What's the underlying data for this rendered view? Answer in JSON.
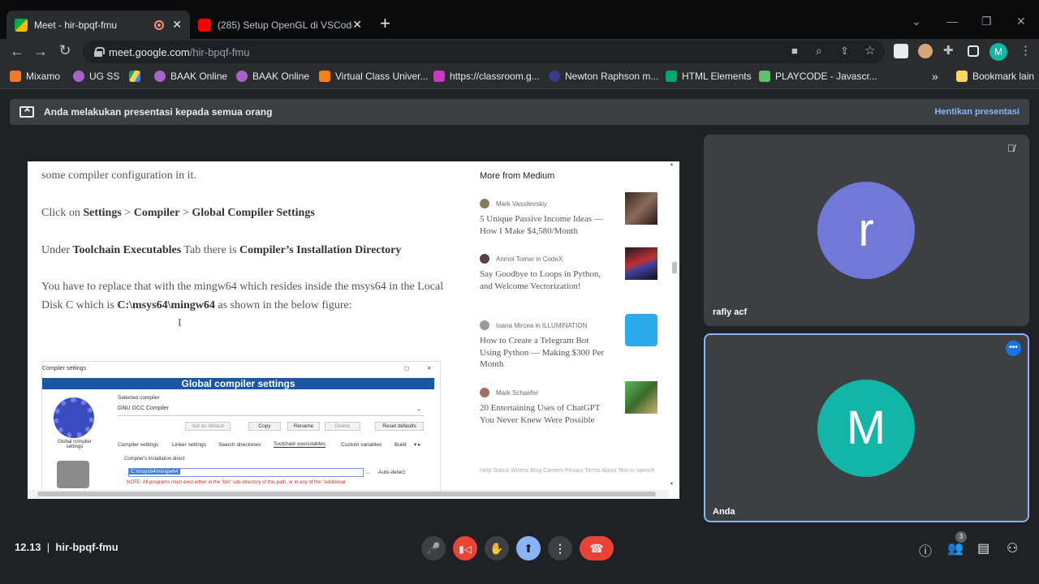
{
  "browser": {
    "tabs": [
      {
        "title": "Meet - hir-bpqf-fmu",
        "close": "✕"
      },
      {
        "title": "(285) Setup OpenGL di VSCode -",
        "close": "✕"
      }
    ],
    "new_tab": "+",
    "window_controls": {
      "chevron": "⌄",
      "minimize": "—",
      "maximize": "❐",
      "close": "✕"
    },
    "url_domain": "meet.google.com",
    "url_path": "/hir-bpqf-fmu",
    "profile_initial": "M",
    "bookmarks": [
      "Mixamo",
      "UG SS",
      "",
      "BAAK Online",
      "BAAK Online",
      "Virtual Class Univer...",
      "https://classroom.g...",
      "Newton Raphson m...",
      "HTML Elements",
      "PLAYCODE - Javascr..."
    ],
    "bookmark_overflow": "»",
    "other_bookmarks": "Bookmark lain"
  },
  "meet": {
    "banner_text": "Anda melakukan presentasi kepada semua orang",
    "stop_presenting": "Hentikan presentasi",
    "time": "12.13",
    "separator": "|",
    "meeting_code": "hir-bpqf-fmu",
    "participants_count": "3",
    "participants": [
      {
        "name": "rafly acf",
        "initial": "r",
        "color": "#7078d8",
        "muted": true
      },
      {
        "name": "Anda",
        "initial": "M",
        "color": "#12b5a6"
      }
    ]
  },
  "article": {
    "line1": "some compiler configuration in it.",
    "click_prefix": "Click on ",
    "click_path_1": "Settings",
    "click_sep_1": " > ",
    "click_path_2": "Compiler",
    "click_sep_2": " > ",
    "click_path_3": "Global Compiler Settings",
    "under_prefix": "Under ",
    "under_tab": "Toolchain Executables",
    "under_mid": " Tab there is ",
    "under_dir": "Compiler’s Installation Directory",
    "replace_prefix": "You have to replace that with the mingw64 which resides inside the msys64 in the Local Disk C which is ",
    "replace_path": "C:\\msys64\\mingw64",
    "replace_suffix": " as shown in the below figure:"
  },
  "dialog": {
    "window_title": "Compiler settings",
    "header": "Global compiler settings",
    "selected_label": "Selected compiler",
    "compiler": "GNU GCC Compiler",
    "buttons": [
      "Set as default",
      "Copy",
      "Rename",
      "Delete",
      "Reset defaults"
    ],
    "tabs": [
      "Compiler settings",
      "Linker settings",
      "Search directories",
      "Toolchain executables",
      "Custom variables",
      "Build"
    ],
    "gear_label": "Global compiler settings",
    "install_label": "Compiler's installation direct",
    "install_path": "C:\\msys64\\mingw64",
    "ellipsis": "...",
    "autodetect": "Auto-detect",
    "note": "NOTE: All programs must exist either in the \"bin\" sub-directory of this path, or in any of the \"Additional"
  },
  "sidebar": {
    "title": "More from Medium",
    "stories": [
      {
        "author": "Mark Vassilevskiy",
        "in": "",
        "title": "5 Unique Passive Income Ideas — How I Make $4,580/Month"
      },
      {
        "author": "Anmol Tomar",
        "in": "in CodeX",
        "title": "Say Goodbye to Loops in Python, and Welcome Vectorization!"
      },
      {
        "author": "Ioana Mircea",
        "in": "in ILLUMINATION",
        "title": "How to Create a Telegram Bot Using Python — Making $300 Per Month"
      },
      {
        "author": "Mark Schaefer",
        "in": "",
        "title": "20 Entertaining Uses of ChatGPT You Never Knew Were Possible"
      }
    ],
    "footer": "Help  Status  Writers  Blog  Careers  Privacy  Terms  About  Text to speech"
  },
  "icons": {
    "mic": "mic-icon",
    "cam_off": "camera-off-icon",
    "hand": "raise-hand-icon",
    "present": "present-screen-icon",
    "more": "more-vert-icon",
    "leave": "end-call-icon",
    "info": "info-icon",
    "people": "people-icon",
    "chat": "chat-icon",
    "activities": "activities-icon"
  }
}
